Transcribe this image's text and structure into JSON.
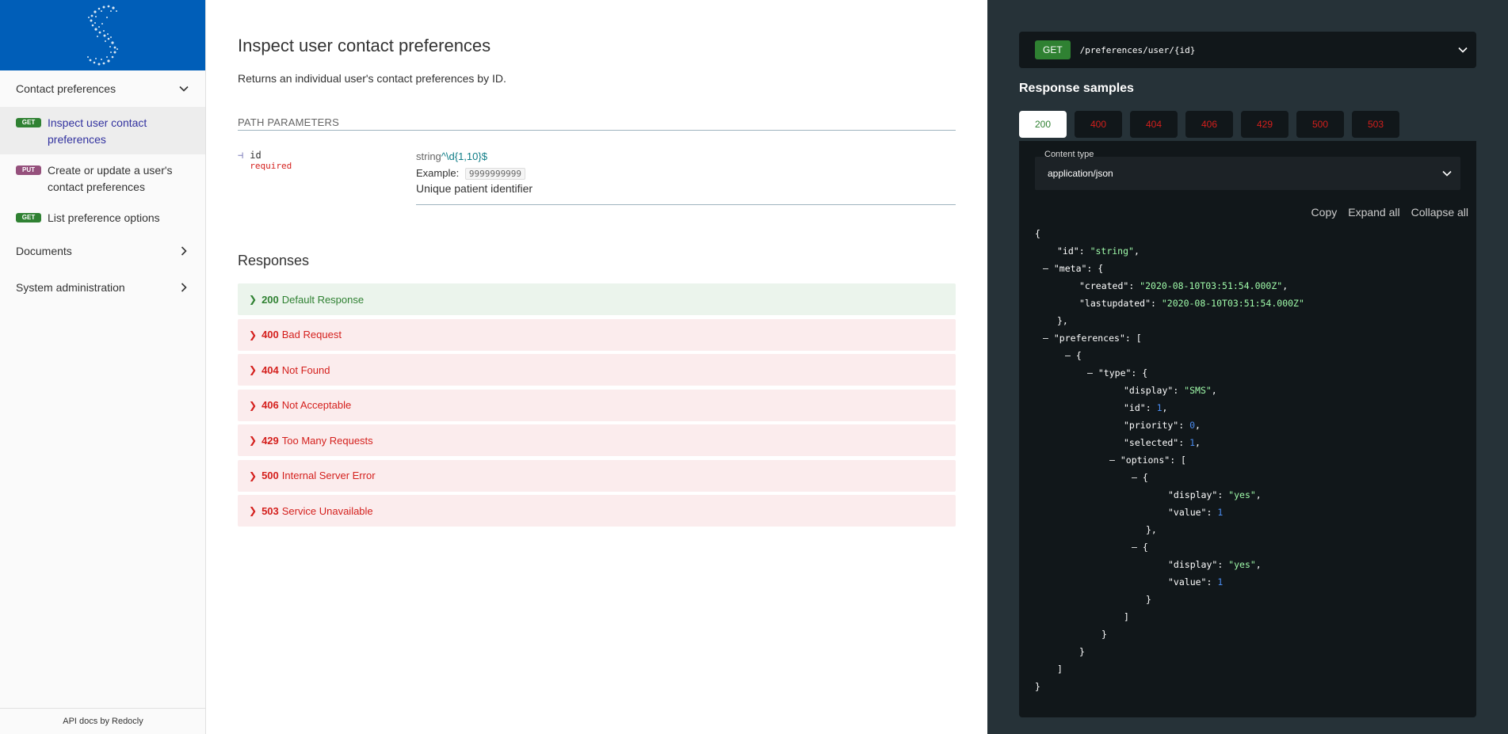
{
  "sidebar": {
    "groups": {
      "contact": "Contact preferences",
      "documents": "Documents",
      "sysadmin": "System administration"
    },
    "ops": [
      {
        "method": "GET",
        "label": "Inspect user contact preferences"
      },
      {
        "method": "PUT",
        "label": "Create or update a user's contact preferences"
      },
      {
        "method": "GET",
        "label": "List preference options"
      }
    ],
    "footer": "API docs by Redocly"
  },
  "operation": {
    "title": "Inspect user contact preferences",
    "description": "Returns an individual user's contact preferences by ID.",
    "params_title": "PATH PARAMETERS",
    "param": {
      "name": "id",
      "required": "required",
      "type": "string",
      "pattern": "^\\d{1,10}$",
      "example_label": "Example:",
      "example": "9999999999",
      "description": "Unique patient identifier"
    },
    "responses_title": "Responses",
    "responses": [
      {
        "code": "200",
        "text": "Default Response"
      },
      {
        "code": "400",
        "text": "Bad Request"
      },
      {
        "code": "404",
        "text": "Not Found"
      },
      {
        "code": "406",
        "text": "Not Acceptable"
      },
      {
        "code": "429",
        "text": "Too Many Requests"
      },
      {
        "code": "500",
        "text": "Internal Server Error"
      },
      {
        "code": "503",
        "text": "Service Unavailable"
      }
    ]
  },
  "right": {
    "method": "GET",
    "path": "/preferences/user/{id}",
    "samples_title": "Response samples",
    "tabs": [
      "200",
      "400",
      "404",
      "406",
      "429",
      "500",
      "503"
    ],
    "content_type_label": "Content type",
    "content_type": "application/json",
    "actions": {
      "copy": "Copy",
      "expand": "Expand all",
      "collapse": "Collapse all"
    },
    "json": {
      "k_id": "\"id\"",
      "v_id": "\"string\"",
      "k_meta": "\"meta\"",
      "k_created": "\"created\"",
      "v_created": "\"2020-08-10T03:51:54.000Z\"",
      "k_lastupdated": "\"lastupdated\"",
      "v_lastupdated": "\"2020-08-10T03:51:54.000Z\"",
      "k_preferences": "\"preferences\"",
      "k_type": "\"type\"",
      "k_display": "\"display\"",
      "v_display": "\"SMS\"",
      "k_tid": "\"id\"",
      "v_tid": "1",
      "k_priority": "\"priority\"",
      "v_priority": "0",
      "k_selected": "\"selected\"",
      "v_selected": "1",
      "k_options": "\"options\"",
      "k_odisplay": "\"display\"",
      "v_odisplay": "\"yes\"",
      "k_ovalue": "\"value\"",
      "v_ovalue": "1"
    }
  }
}
